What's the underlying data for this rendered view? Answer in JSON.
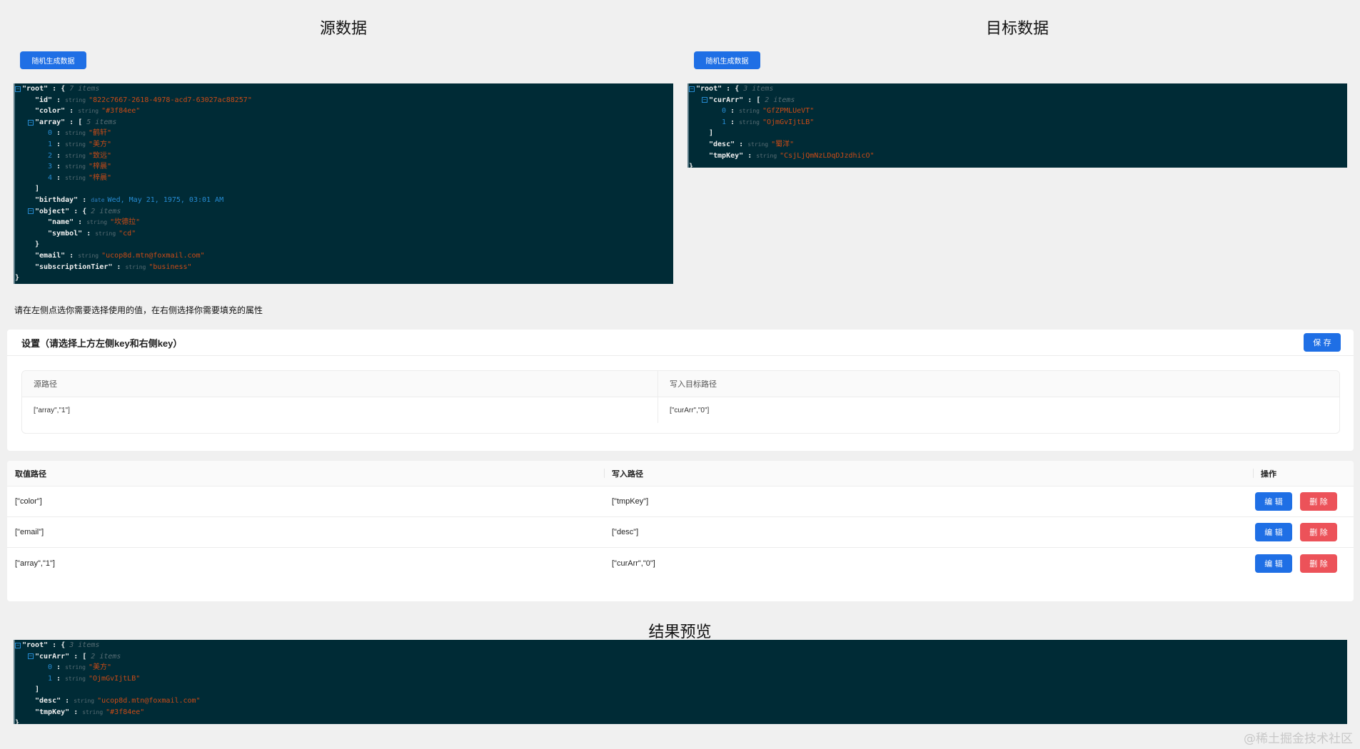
{
  "source": {
    "title": "源数据",
    "random_button": "随机生成数据",
    "json": [
      {
        "d": 0,
        "c": 1,
        "k": "\"root\"",
        "brace": "{",
        "count": "7 items"
      },
      {
        "d": 1,
        "k": "\"id\"",
        "t": "string",
        "v": "\"822c7667-2618-4978-acd7-63027ac88257\""
      },
      {
        "d": 1,
        "k": "\"color\"",
        "t": "string",
        "v": "\"#3f84ee\""
      },
      {
        "d": 1,
        "c": 1,
        "k": "\"array\"",
        "brace": "[",
        "count": "5 items"
      },
      {
        "d": 2,
        "i": "0",
        "t": "string",
        "v": "\"鹤轩\""
      },
      {
        "d": 2,
        "i": "1",
        "t": "string",
        "v": "\"美方\""
      },
      {
        "d": 2,
        "i": "2",
        "t": "string",
        "v": "\"致远\""
      },
      {
        "d": 2,
        "i": "3",
        "t": "string",
        "v": "\"梓晨\""
      },
      {
        "d": 2,
        "i": "4",
        "t": "string",
        "v": "\"梓晨\""
      },
      {
        "d": 1,
        "end": "]"
      },
      {
        "d": 1,
        "k": "\"birthday\"",
        "t": "date",
        "v": "Wed, May 21, 1975, 03:01 AM",
        "date": true
      },
      {
        "d": 1,
        "c": 1,
        "k": "\"object\"",
        "brace": "{",
        "count": "2 items"
      },
      {
        "d": 2,
        "k": "\"name\"",
        "t": "string",
        "v": "\"坎德拉\""
      },
      {
        "d": 2,
        "k": "\"symbol\"",
        "t": "string",
        "v": "\"cd\""
      },
      {
        "d": 1,
        "end": "}"
      },
      {
        "d": 1,
        "k": "\"email\"",
        "t": "string",
        "v": "\"ucop8d.mtn@foxmail.com\""
      },
      {
        "d": 1,
        "k": "\"subscriptionTier\"",
        "t": "string",
        "v": "\"business\""
      },
      {
        "d": 0,
        "end": "}"
      }
    ]
  },
  "target": {
    "title": "目标数据",
    "random_button": "随机生成数据",
    "json": [
      {
        "d": 0,
        "c": 1,
        "k": "\"root\"",
        "brace": "{",
        "count": "3 items"
      },
      {
        "d": 1,
        "c": 1,
        "k": "\"curArr\"",
        "brace": "[",
        "count": "2 items"
      },
      {
        "d": 2,
        "i": "0",
        "t": "string",
        "v": "\"GfZPMLUeVT\""
      },
      {
        "d": 2,
        "i": "1",
        "t": "string",
        "v": "\"OjmGvIjtLB\""
      },
      {
        "d": 1,
        "end": "]"
      },
      {
        "d": 1,
        "k": "\"desc\"",
        "t": "string",
        "v": "\"蜀洋\""
      },
      {
        "d": 1,
        "k": "\"tmpKey\"",
        "t": "string",
        "v": "\"CsjLjQmNzLDqDJzdhicO\""
      },
      {
        "d": 0,
        "end": "}"
      }
    ]
  },
  "hint": "请在左侧点选你需要选择使用的值，在右侧选择你需要填充的属性",
  "settings": {
    "title": "设置（请选择上方左侧key和右侧key）",
    "save_button": "保 存",
    "col_source": "源路径",
    "col_target": "写入目标路径",
    "source_path": "[\"array\",\"1\"]",
    "target_path": "[\"curArr\",\"0\"]"
  },
  "rules": {
    "headers": {
      "source": "取值路径",
      "target": "写入路径",
      "actions": "操作"
    },
    "edit_label": "编 辑",
    "delete_label": "删 除",
    "rows": [
      {
        "source": "[\"color\"]",
        "target": "[\"tmpKey\"]"
      },
      {
        "source": "[\"email\"]",
        "target": "[\"desc\"]"
      },
      {
        "source": "[\"array\",\"1\"]",
        "target": "[\"curArr\",\"0\"]"
      }
    ]
  },
  "preview": {
    "title": "结果预览",
    "json": [
      {
        "d": 0,
        "c": 1,
        "k": "\"root\"",
        "brace": "{",
        "count": "3 items"
      },
      {
        "d": 1,
        "c": 1,
        "k": "\"curArr\"",
        "brace": "[",
        "count": "2 items"
      },
      {
        "d": 2,
        "i": "0",
        "t": "string",
        "v": "\"美方\""
      },
      {
        "d": 2,
        "i": "1",
        "t": "string",
        "v": "\"OjmGvIjtLB\""
      },
      {
        "d": 1,
        "end": "]"
      },
      {
        "d": 1,
        "k": "\"desc\"",
        "t": "string",
        "v": "\"ucop8d.mtn@foxmail.com\""
      },
      {
        "d": 1,
        "k": "\"tmpKey\"",
        "t": "string",
        "v": "\"#3f84ee\""
      },
      {
        "d": 0,
        "end": "}"
      }
    ]
  },
  "watermark": "@稀土掘金技术社区",
  "colors": {
    "primary": "#1f6fe5",
    "danger": "#ec5259",
    "json_bg": "#002b36",
    "string": "#cb4b16",
    "index": "#268bd2"
  }
}
